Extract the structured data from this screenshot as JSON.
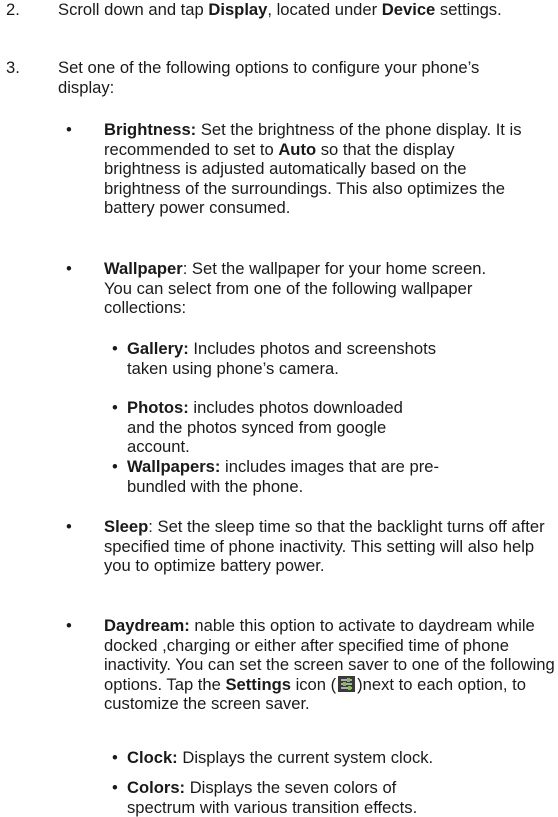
{
  "steps": [
    {
      "num": "2.",
      "t1": "Scroll down and tap ",
      "b1": "Display",
      "t2": ", located under ",
      "b2": "Device",
      "t3": " settings."
    },
    {
      "num": "3.",
      "text": "Set one of the following options to configure your phone’s display:"
    }
  ],
  "bullet_symbol": "•",
  "options": {
    "brightness": {
      "label": "Brightness:",
      "t1": " Set the brightness of the phone display. It is recommended to set to ",
      "b1": "Auto",
      "t2": " so that the display brightness is adjusted automatically based on the brightness of the surroundings. This also optimizes the battery power consumed."
    },
    "wallpaper": {
      "label": "Wallpaper",
      "text": ": Set the wallpaper for your home screen. You can select from one of the following wallpaper collections:",
      "subs": [
        {
          "label": "Gallery:",
          "text": " Includes photos and screenshots taken using phone’s camera."
        },
        {
          "label": "Photos:",
          "text": "  includes photos downloaded and the photos synced from google account."
        },
        {
          "label": "Wallpapers:",
          "text": " includes images that are pre-bundled with the phone."
        }
      ]
    },
    "sleep": {
      "label": "Sleep",
      "text": ": Set the sleep time so that the backlight turns off after specified time of phone inactivity. This setting will also help you to optimize battery power."
    },
    "daydream": {
      "label": "Daydream:",
      "t1": " nable this option to activate to daydream while docked ,charging or either after specified time of phone inactivity. You can set the screen saver to one of the following options. Tap the ",
      "b1": "Settings",
      "t2": " icon (",
      "t3": ")next to each option, to customize the screen saver.",
      "subs": [
        {
          "label": "Clock:",
          "text": " Displays the current system clock."
        },
        {
          "label": "Colors:",
          "text": " Displays the seven colors of spectrum with various transition effects."
        }
      ]
    }
  }
}
